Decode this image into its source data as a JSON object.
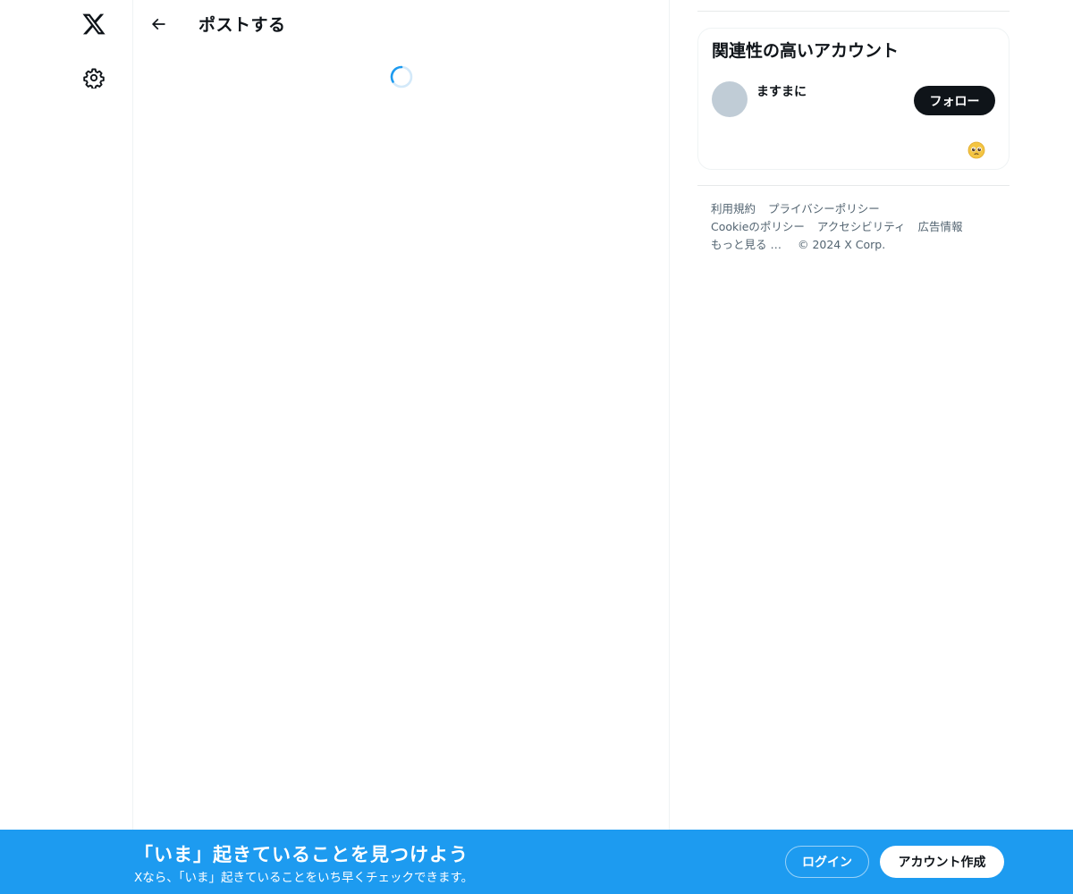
{
  "nav": {
    "logo_icon": "x-logo-icon",
    "settings_icon": "gear-icon"
  },
  "main": {
    "back_icon": "arrow-left-icon",
    "title": "ポストする",
    "loading_icon": "spinner-icon"
  },
  "sidebar": {
    "related_title": "関連性の高いアカウント",
    "accounts": [
      {
        "name": "ますまに",
        "follow_label": "フォロー",
        "emoji": "pleading-face-icon"
      }
    ],
    "footer": {
      "terms": "利用規約",
      "privacy": "プライバシーポリシー",
      "cookie": "Cookieのポリシー",
      "accessibility": "アクセシビリティ",
      "ads": "広告情報",
      "more": "もっと見る …",
      "copyright": "© 2024 X Corp."
    }
  },
  "bottom_bar": {
    "headline": "「いま」起きていることを見つけよう",
    "subtext": "Xなら、「いま」起きていることをいち早くチェックできます。",
    "login_label": "ログイン",
    "signup_label": "アカウント作成"
  },
  "colors": {
    "accent": "#1d9bf0",
    "text": "#0f1419",
    "muted": "#536471",
    "border": "#eff3f4"
  }
}
